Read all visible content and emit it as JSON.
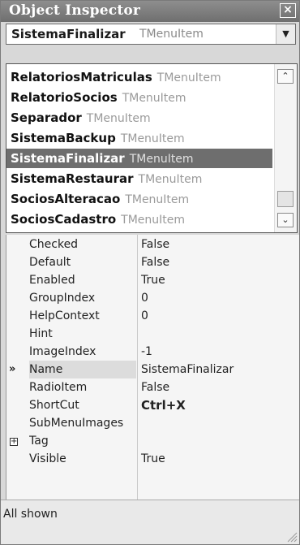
{
  "window": {
    "title": "Object Inspector",
    "close_glyph": "×"
  },
  "selector": {
    "name": "SistemaFinalizar",
    "type": "TMenuItem",
    "arrow": "▼"
  },
  "dropdown": {
    "items": [
      {
        "name": "RelatoriosMatriculas",
        "type": "TMenuItem"
      },
      {
        "name": "RelatorioSocios",
        "type": "TMenuItem"
      },
      {
        "name": "Separador",
        "type": "TMenuItem"
      },
      {
        "name": "SistemaBackup",
        "type": "TMenuItem"
      },
      {
        "name": "SistemaFinalizar",
        "type": "TMenuItem"
      },
      {
        "name": "SistemaRestaurar",
        "type": "TMenuItem"
      },
      {
        "name": "SociosAlteracao",
        "type": "TMenuItem"
      },
      {
        "name": "SociosCadastro",
        "type": "TMenuItem"
      }
    ],
    "selected_index": 4,
    "scroll_up": "⌃",
    "scroll_down": "⌄"
  },
  "properties": [
    {
      "name": "Checked",
      "value": "False"
    },
    {
      "name": "Default",
      "value": "False"
    },
    {
      "name": "Enabled",
      "value": "True"
    },
    {
      "name": "GroupIndex",
      "value": "0"
    },
    {
      "name": "HelpContext",
      "value": "0"
    },
    {
      "name": "Hint",
      "value": ""
    },
    {
      "name": "ImageIndex",
      "value": "-1"
    },
    {
      "name": "Name",
      "value": "SistemaFinalizar"
    },
    {
      "name": "RadioItem",
      "value": "False"
    },
    {
      "name": "ShortCut",
      "value": "Ctrl+X"
    },
    {
      "name": "SubMenuImages",
      "value": ""
    },
    {
      "name": "Tag",
      "value": ""
    },
    {
      "name": "Visible",
      "value": "True"
    }
  ],
  "active_marker": "»",
  "expand_glyph": "+",
  "status": {
    "text": "All shown"
  },
  "colors": {
    "titlebar": "#7a7a7a",
    "selection": "#6e6e6e",
    "type_text": "#9a9a9a"
  }
}
